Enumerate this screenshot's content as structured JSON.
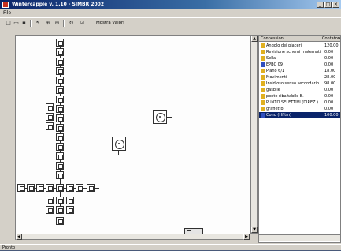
{
  "window": {
    "title": "Wintercapple v. 1.10 - SIMBR 2002"
  },
  "menu": {
    "file_label": "File"
  },
  "toolbar": {
    "label": "Mostra valori"
  },
  "panel": {
    "columns": [
      "Connessioni",
      "Contatore"
    ],
    "rows": [
      {
        "name": "Angolo dei piaceri",
        "value": "120.00",
        "color": "#e0b020"
      },
      {
        "name": "Revisione schemi matematici",
        "value": "0.00",
        "color": "#e0b020"
      },
      {
        "name": "Sella",
        "value": "0.00",
        "color": "#e0b020"
      },
      {
        "name": "EPBC 09",
        "value": "0.00",
        "color": "#3050c0"
      },
      {
        "name": "Piano 6/1",
        "value": "18.00",
        "color": "#e0b020"
      },
      {
        "name": "Movimenti",
        "value": "28.00",
        "color": "#e0b020"
      },
      {
        "name": "Insidioso senso secondario",
        "value": "98.00",
        "color": "#e0b020"
      },
      {
        "name": "gasbile",
        "value": "0.00",
        "color": "#e0b020"
      },
      {
        "name": "ponte ribaltabile B.",
        "value": "0.00",
        "color": "#e0b020"
      },
      {
        "name": "PUNTO SELETTIVI (DIREZ.)",
        "value": "0.00",
        "color": "#e0b020"
      },
      {
        "name": "grafietto",
        "value": "0.00",
        "color": "#e0b020"
      },
      {
        "name": "Cono (Hfitm)",
        "value": "100.00",
        "color": "#3050c0",
        "selected": true
      }
    ]
  },
  "status": {
    "text": "Pronto"
  }
}
